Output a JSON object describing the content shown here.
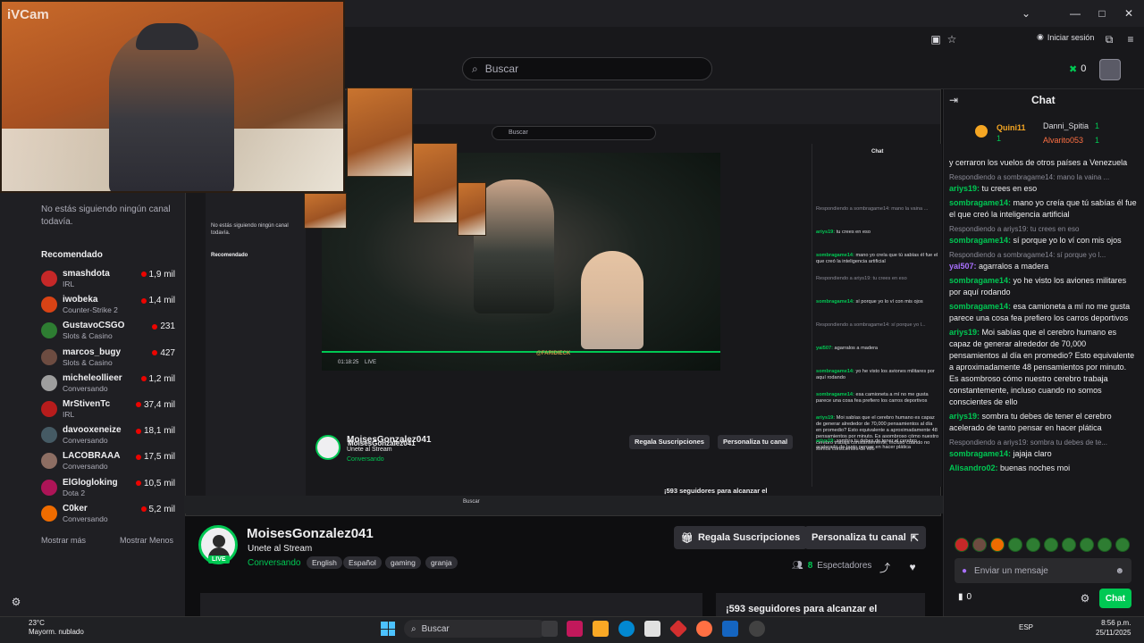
{
  "browser": {
    "login_label": "Iniciar sesión",
    "search_placeholder": "Buscar",
    "points": "0"
  },
  "webcam": {
    "watermark": "iVCam"
  },
  "sidebar": {
    "empty_note": "No estás siguiendo ningún canal todavía.",
    "recommended_title": "Recomendado",
    "channels": [
      {
        "name": "smashdota",
        "game": "IRL",
        "viewers": "1,9 mil",
        "color": "#c62828"
      },
      {
        "name": "iwobeka",
        "game": "Counter-Strike 2",
        "viewers": "1,4 mil",
        "color": "#d84315"
      },
      {
        "name": "GustavoCSGO",
        "game": "Slots & Casino",
        "viewers": "231",
        "color": "#2e7d32"
      },
      {
        "name": "marcos_bugy",
        "game": "Slots & Casino",
        "viewers": "427",
        "color": "#6d4c41"
      },
      {
        "name": "micheleollieer",
        "game": "Conversando",
        "viewers": "1,2 mil",
        "color": "#9e9e9e"
      },
      {
        "name": "MrStivenTc",
        "game": "IRL",
        "viewers": "37,4 mil",
        "color": "#b71c1c"
      },
      {
        "name": "davooxeneize",
        "game": "Conversando",
        "viewers": "18,1 mil",
        "color": "#455a64"
      },
      {
        "name": "LACOBRAAA",
        "game": "Conversando",
        "viewers": "17,5 mil",
        "color": "#8d6e63"
      },
      {
        "name": "ElGlogloking",
        "game": "Dota 2",
        "viewers": "10,5 mil",
        "color": "#ad1457"
      },
      {
        "name": "C0ker",
        "game": "Conversando",
        "viewers": "5,2 mil",
        "color": "#ef6c00"
      }
    ],
    "show_more": "Mostrar más",
    "show_less": "Mostrar Menos"
  },
  "video": {
    "watermark": "@FARIDIECK",
    "time": "01:18:25",
    "live": "LIVE"
  },
  "stream": {
    "name": "MoisesGonzalez041",
    "title": "Unete al Stream",
    "category": "Conversando",
    "live_badge": "LIVE",
    "tags": [
      "English",
      "Español",
      "gaming",
      "granja"
    ],
    "subs_button": "Regala Suscripciones",
    "customize_button": "Personaliza tu canal",
    "viewers_count": "8",
    "viewers_label": "Espectadores",
    "goal_text": "¡593 seguidores para alcanzar el"
  },
  "chat": {
    "title": "Chat",
    "gifters": [
      {
        "name": "Quini11",
        "count": "1"
      },
      {
        "name": "Danni_Spitia",
        "count": "1"
      },
      {
        "name": "Alvarito053",
        "count": "1"
      }
    ],
    "messages": [
      {
        "type": "text",
        "user": "",
        "text": "y cerraron los vuelos de otros países a Venezuela"
      },
      {
        "type": "reply",
        "text": "Respondiendo a sombragame14: mano la vaina ..."
      },
      {
        "type": "text",
        "user": "ariys19",
        "text": "tu crees en eso"
      },
      {
        "type": "text",
        "user": "sombragame14",
        "text": "mano yo creía que tú sabías él fue el que creó la inteligencia artificial"
      },
      {
        "type": "reply",
        "text": "Respondiendo a ariys19: tu crees en eso"
      },
      {
        "type": "text",
        "user": "sombragame14",
        "text": "sí porque yo lo ví con mis ojos"
      },
      {
        "type": "reply",
        "text": "Respondiendo a sombragame14: sí porque yo l..."
      },
      {
        "type": "text",
        "user": "yai507",
        "text": "agarralos a madera",
        "purple": true
      },
      {
        "type": "text",
        "user": "sombragame14",
        "text": "yo he visto los aviones militares por aquí rodando"
      },
      {
        "type": "text",
        "user": "sombragame14",
        "text": "esa camioneta a mí no me gusta parece una cosa fea prefiero los carros deportivos"
      },
      {
        "type": "text",
        "user": "ariys19",
        "text": "Moi sabías que el cerebro humano es capaz de generar alrededor de 70,000 pensamientos al día en promedio? Esto equivalente a aproximadamente 48 pensamientos por minuto. Es asombroso cómo nuestro cerebro trabaja constantemente, incluso cuando no somos conscientes de ello"
      },
      {
        "type": "text",
        "user": "ariys19",
        "text": "sombra tu debes de tener el cerebro acelerado de tanto pensar en hacer plática"
      },
      {
        "type": "reply",
        "text": "Respondiendo a ariys19: sombra tu debes de te..."
      },
      {
        "type": "text",
        "user": "sombragame14",
        "text": "jajaja claro"
      },
      {
        "type": "text",
        "user": "Alisandro02",
        "text": "buenas noches moi"
      }
    ],
    "input_placeholder": "Enviar un mensaje",
    "bits": "0",
    "send_button": "Chat"
  },
  "taskbar": {
    "temperature": "23°C",
    "weather": "Mayorm. nublado",
    "search": "Buscar",
    "lang": "ESP",
    "time": "8:56 p.m.",
    "date": "25/11/2025"
  }
}
